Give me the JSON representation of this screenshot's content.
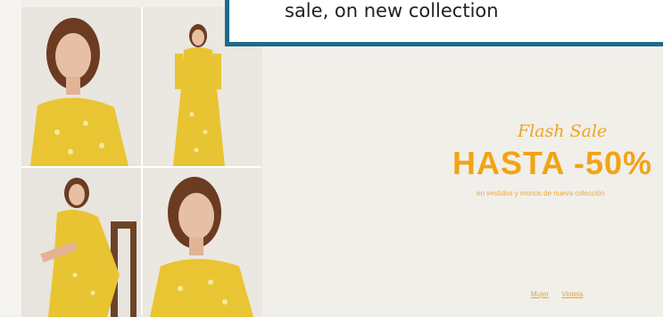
{
  "promo": {
    "script_title": "Flash Sale",
    "headline": "HASTA -50%",
    "subline": "en vestidos y monos de nueva colección"
  },
  "links": [
    {
      "label": "Mujer"
    },
    {
      "label": "Violeta"
    }
  ],
  "callout": {
    "text": "sale, on new collection"
  },
  "colors": {
    "accent": "#f3a314",
    "background": "#f1efea",
    "callout_border": "#1d6a8c"
  },
  "photos": [
    {
      "name": "model-portrait-1"
    },
    {
      "name": "model-full-length"
    },
    {
      "name": "model-seated-chair"
    },
    {
      "name": "model-portrait-2"
    }
  ]
}
